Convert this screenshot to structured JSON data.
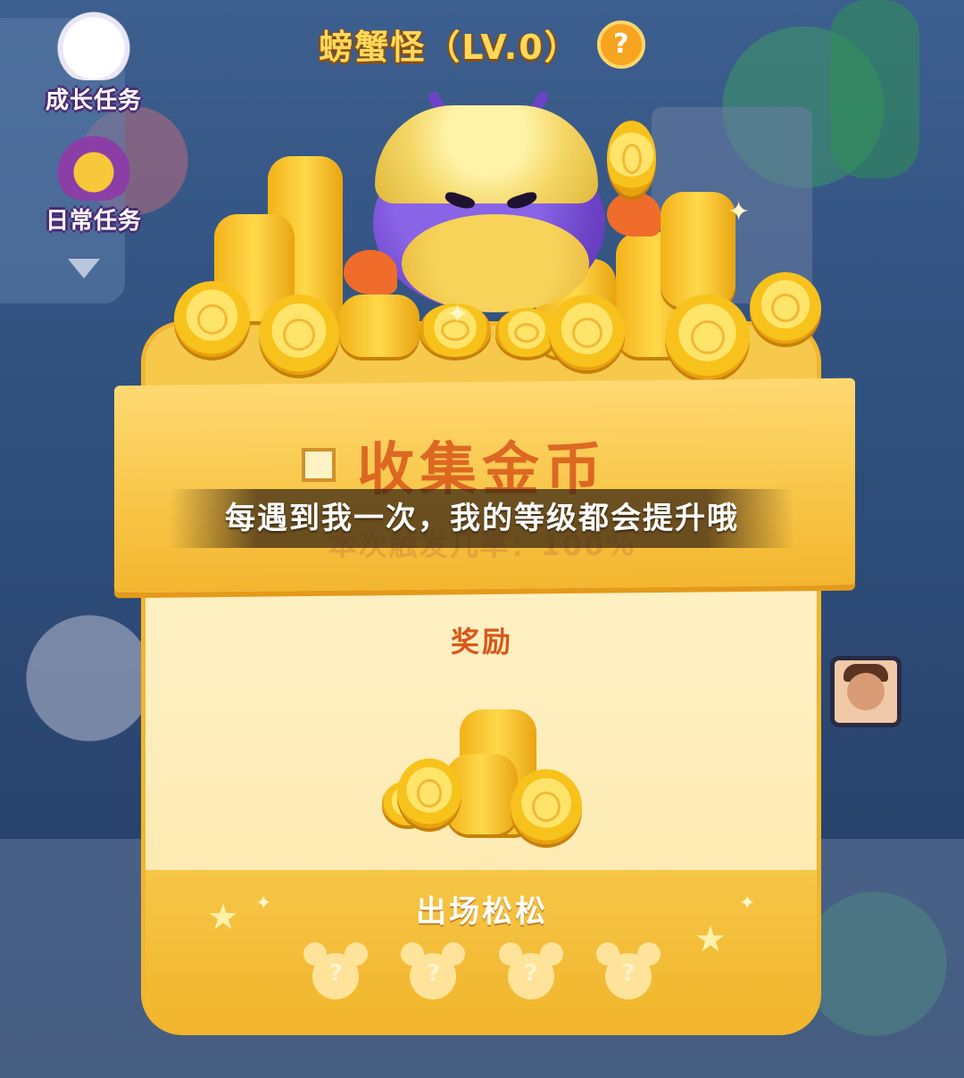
{
  "header": {
    "title": "螃蟹怪（LV.0）",
    "help_icon": "?"
  },
  "side_tasks": {
    "growth": {
      "label": "成长任务",
      "icon": "cloud-mascot-icon"
    },
    "daily": {
      "label": "日常任务",
      "icon": "treasure-chest-icon"
    }
  },
  "card": {
    "title": "收集金币",
    "subtitle": "本次触发几率：100%",
    "speech": "每遇到我一次，我的等级都会提升哦",
    "reward_label": "奖励",
    "appear_label": "出场松松",
    "slots": [
      "?",
      "?",
      "?",
      "?"
    ]
  },
  "colors": {
    "accent": "#f6c94d",
    "title_red": "#d8571a",
    "crab_purple": "#6c43c7"
  }
}
